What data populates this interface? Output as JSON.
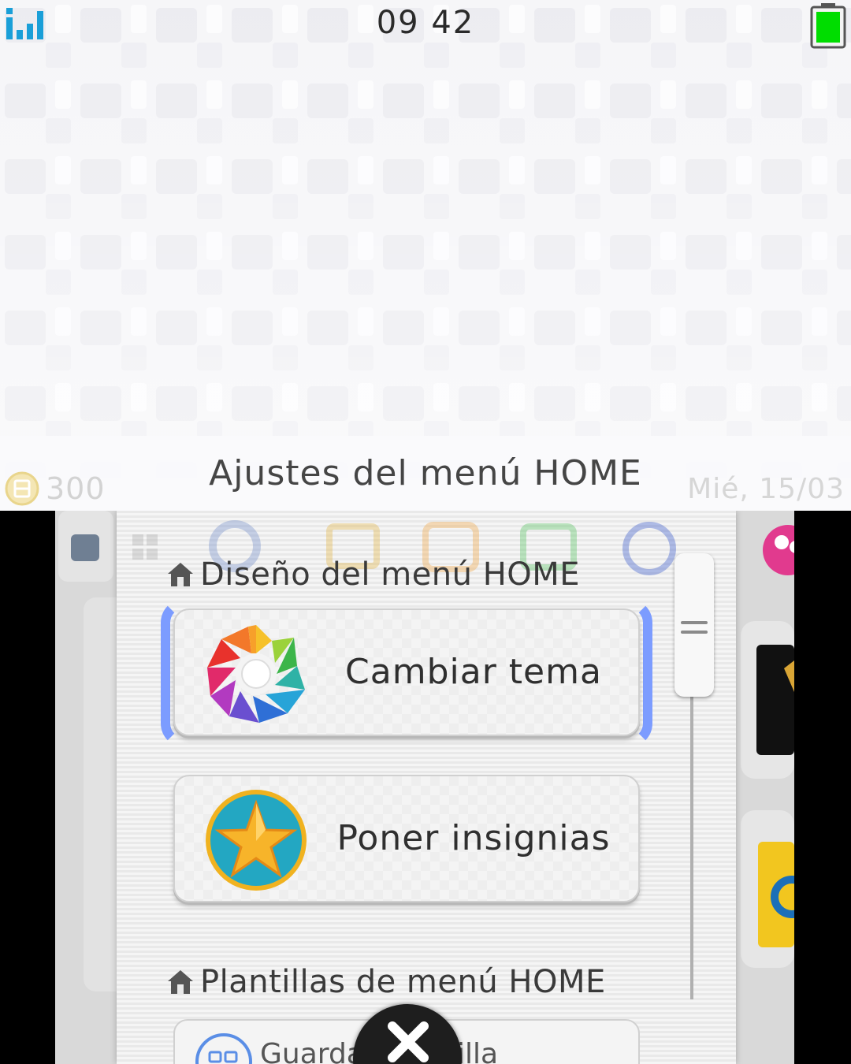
{
  "top_screen": {
    "status": {
      "time": "09 42"
    },
    "title": "Ajustes del menú HOME",
    "coins": "300",
    "date": "Mié, 15/03"
  },
  "bottom_screen": {
    "sections": [
      {
        "header": "Diseño del menú HOME"
      },
      {
        "header": "Plantillas de menú HOME"
      }
    ],
    "buttons": [
      {
        "label": "Cambiar tema",
        "icon": "theme-gear-icon",
        "selected": true
      },
      {
        "label": "Poner insignias",
        "icon": "badge-star-icon",
        "selected": false
      },
      {
        "label": "Guardar plantilla",
        "icon": "folder-icon",
        "selected": false
      }
    ],
    "close_icon": "close-icon"
  },
  "colors": {
    "selection": "#7c9cff",
    "battery": "#00dd00",
    "signal": "#1a9fd8"
  }
}
